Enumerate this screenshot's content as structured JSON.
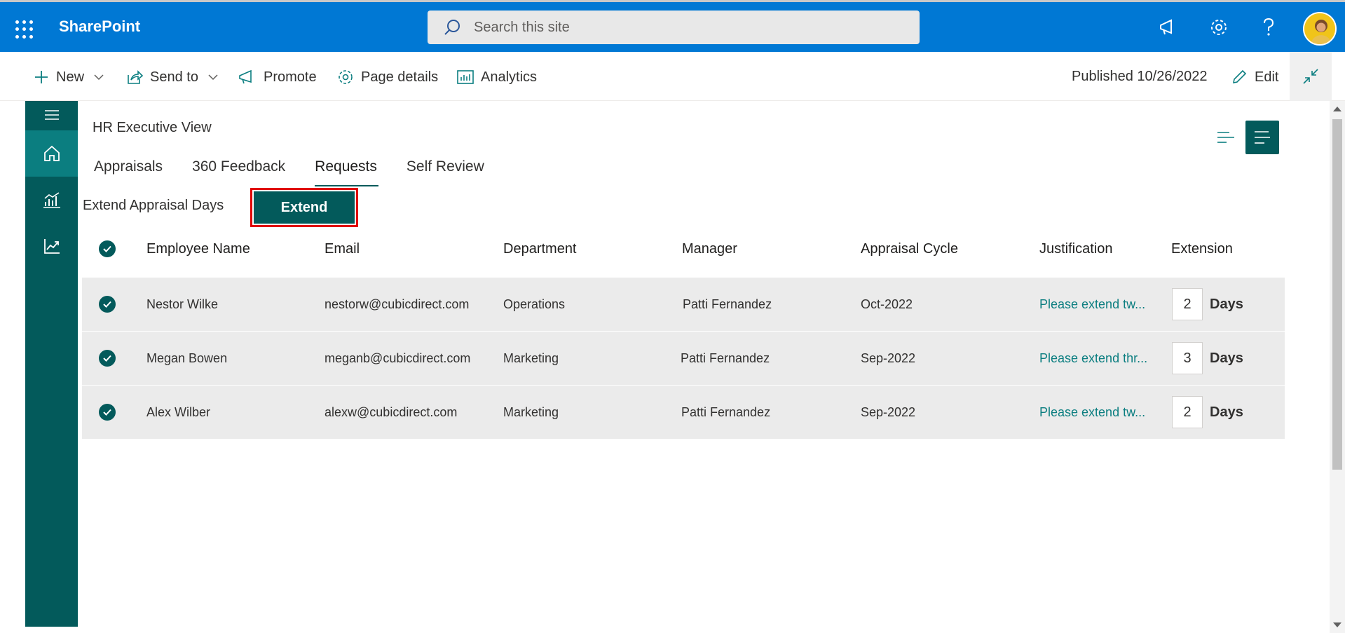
{
  "suitebar": {
    "brand": "SharePoint",
    "search_placeholder": "Search this site"
  },
  "commandbar": {
    "new_label": "New",
    "send_to_label": "Send to",
    "promote_label": "Promote",
    "page_details_label": "Page details",
    "analytics_label": "Analytics",
    "published_text": "Published 10/26/2022",
    "edit_label": "Edit"
  },
  "rail": {
    "items": [
      "menu-icon",
      "home-icon",
      "analytics-icon",
      "trend-icon"
    ]
  },
  "page": {
    "title": "HR Executive View",
    "tabs": [
      {
        "label": "Appraisals",
        "active": false
      },
      {
        "label": "360 Feedback",
        "active": false
      },
      {
        "label": "Requests",
        "active": true
      },
      {
        "label": "Self Review",
        "active": false
      }
    ],
    "extend_label": "Extend Appraisal Days",
    "extend_button": "Extend"
  },
  "table": {
    "headers": [
      "Employee Name",
      "Email",
      "Department",
      "Manager",
      "Appraisal Cycle",
      "Justification",
      "Extension"
    ],
    "rows": [
      {
        "name": "Nestor Wilke",
        "email": "nestorw@cubicdirect.com",
        "department": "Operations",
        "manager": "Patti Fernandez",
        "cycle": "Oct-2022",
        "justification": "Please extend tw...",
        "extension": "2",
        "unit": "Days"
      },
      {
        "name": "Megan Bowen",
        "email": "meganb@cubicdirect.com",
        "department": "Marketing",
        "manager": "Patti Fernandez",
        "cycle": "Sep-2022",
        "justification": "Please extend thr...",
        "extension": "3",
        "unit": "Days"
      },
      {
        "name": "Alex Wilber",
        "email": "alexw@cubicdirect.com",
        "department": "Marketing",
        "manager": "Patti Fernandez",
        "cycle": "Sep-2022",
        "justification": "Please extend tw...",
        "extension": "2",
        "unit": "Days"
      }
    ]
  },
  "colors": {
    "suitebar": "#0078d4",
    "accent": "#035a5b",
    "accent_light": "#0b7e80",
    "highlight_border": "#e00000"
  }
}
